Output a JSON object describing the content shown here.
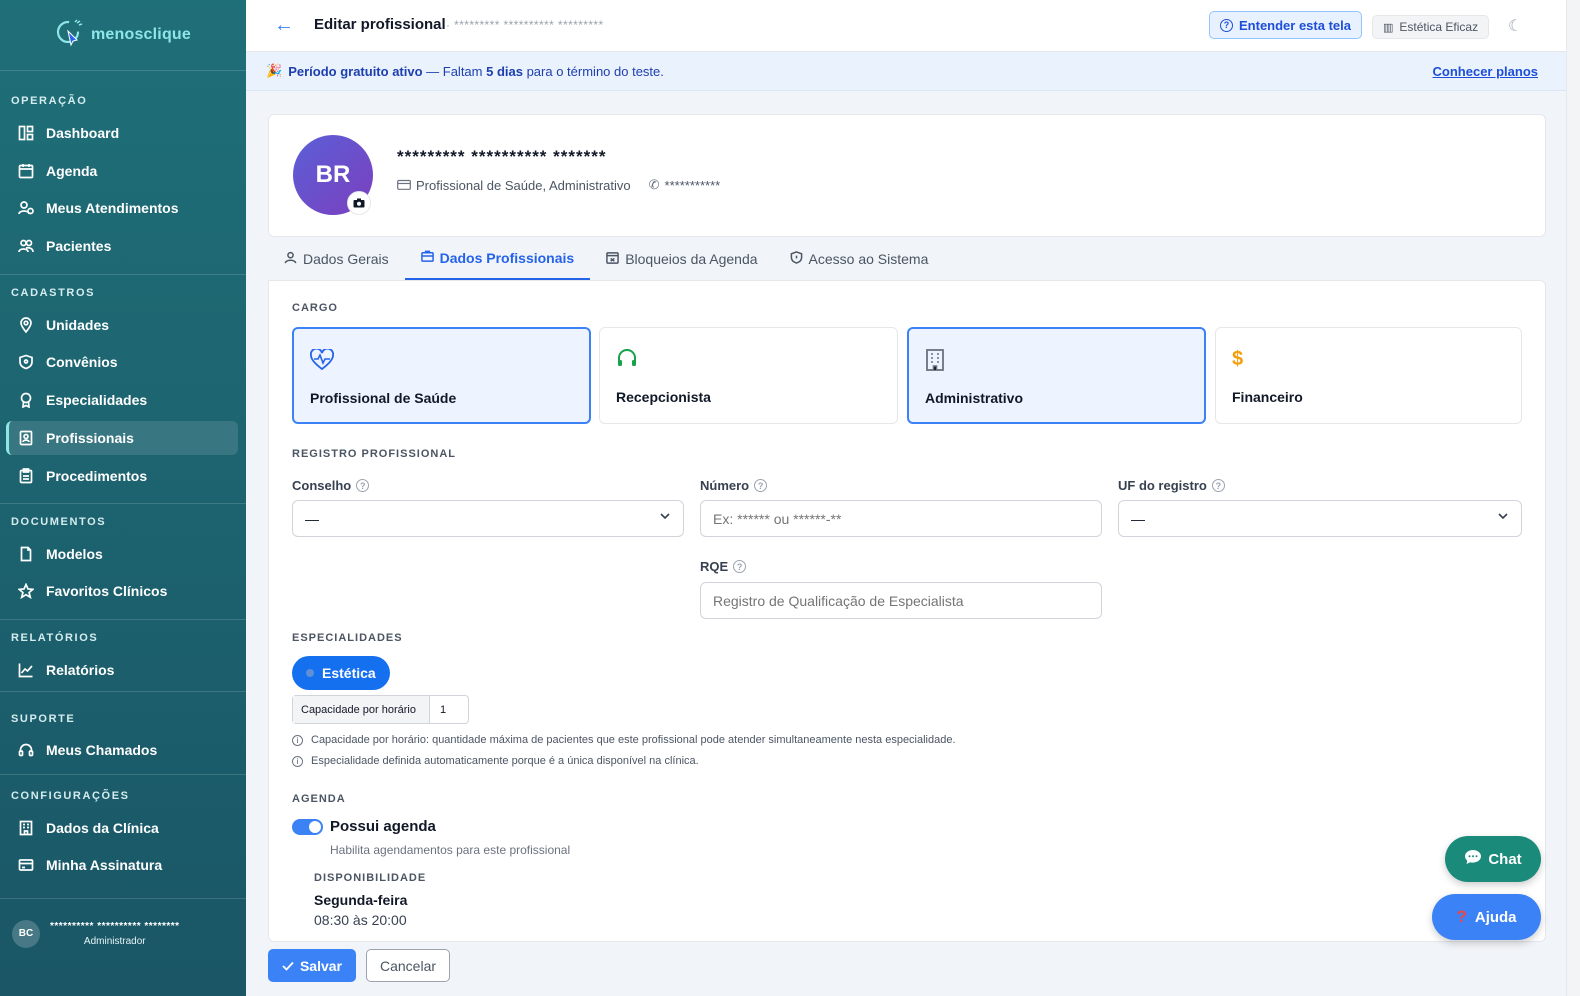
{
  "sidebar": {
    "logo": "menosclique",
    "sections": {
      "operacao": "OPERAÇÃO",
      "cadastros": "CADASTROS",
      "documentos": "DOCUMENTOS",
      "relatorios": "RELATÓRIOS",
      "suporte": "SUPORTE",
      "configuracoes": "CONFIGURAÇÕES"
    },
    "items": {
      "dashboard": "Dashboard",
      "agenda": "Agenda",
      "meus_atendimentos": "Meus Atendimentos",
      "pacientes": "Pacientes",
      "unidades": "Unidades",
      "convenios": "Convênios",
      "especialidades": "Especialidades",
      "profissionais": "Profissionais",
      "procedimentos": "Procedimentos",
      "modelos": "Modelos",
      "favoritos": "Favoritos Clínicos",
      "relatorios": "Relatórios",
      "chamados": "Meus Chamados",
      "dados_clinica": "Dados da Clínica",
      "assinatura": "Minha Assinatura"
    },
    "user": {
      "initials": "BC",
      "name": "********** ********** ********",
      "role": "Administrador"
    }
  },
  "topbar": {
    "title": "Editar profissional",
    "subtitle": "· ********* ********** *********",
    "understand_button": "Entender esta tela",
    "clinic_button": "Estética Eficaz"
  },
  "trial": {
    "strong": "Período gratuito ativo",
    "middle": " — Faltam ",
    "days": "5 dias",
    "rest": " para o término do teste.",
    "link": "Conhecer planos"
  },
  "profile": {
    "initials": "BR",
    "name": "********* ********** *******",
    "roles": "Profissional de Saúde, Administrativo",
    "phone": "***********"
  },
  "tabs": {
    "dados_gerais": "Dados Gerais",
    "dados_profissionais": "Dados Profissionais",
    "bloqueios": "Bloqueios da Agenda",
    "acesso": "Acesso ao Sistema"
  },
  "cargo": {
    "label": "CARGO",
    "options": {
      "saude": "Profissional de Saúde",
      "recepcionista": "Recepcionista",
      "administrativo": "Administrativo",
      "financeiro": "Financeiro"
    }
  },
  "registro": {
    "label": "REGISTRO PROFISSIONAL",
    "conselho_label": "Conselho",
    "conselho_value": "—",
    "numero_label": "Número",
    "numero_placeholder": "Ex: ****** ou ******-**",
    "uf_label": "UF do registro",
    "uf_value": "—",
    "rqe_label": "RQE",
    "rqe_placeholder": "Registro de Qualificação de Especialista"
  },
  "especialidades": {
    "label": "ESPECIALIDADES",
    "chip": "Estética",
    "capacity_label": "Capacidade por horário",
    "capacity_value": "1",
    "note1": "Capacidade por horário: quantidade máxima de pacientes que este profissional pode atender simultaneamente nesta especialidade.",
    "note2": "Especialidade definida automaticamente porque é a única disponível na clínica."
  },
  "agenda": {
    "label": "AGENDA",
    "toggle_label": "Possui agenda",
    "toggle_sub": "Habilita agendamentos para este profissional",
    "dispo_label": "DISPONIBILIDADE",
    "day": "Segunda-feira",
    "hours": "08:30 às 20:00"
  },
  "actions": {
    "save": "Salvar",
    "cancel": "Cancelar"
  },
  "fab": {
    "chat": "Chat",
    "help": "Ajuda"
  },
  "colors": {
    "sidebar": "#1d6470",
    "primary": "#3b82f6",
    "chat": "#1a8a7a"
  }
}
